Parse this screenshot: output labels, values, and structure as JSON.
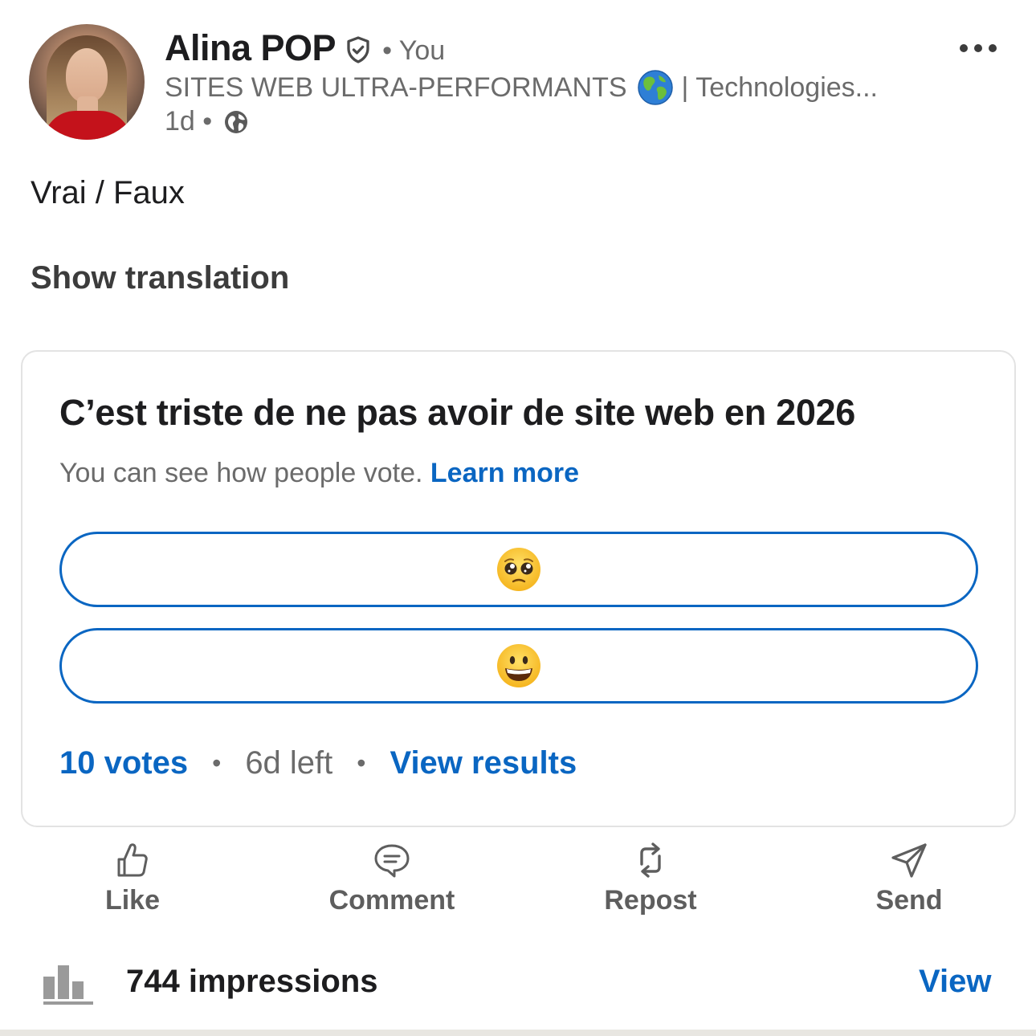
{
  "author": {
    "name": "Alina POP",
    "relation": "• You",
    "headline_text": "SITES WEB ULTRA-PERFORMANTS",
    "headline_suffix": "| Technologies...",
    "time": "1d •",
    "verified_icon": "verified-shield-icon",
    "visibility_icon": "globe-icon"
  },
  "post": {
    "text": "Vrai / Faux",
    "translate_label": "Show translation"
  },
  "poll": {
    "question": "C’est triste de ne pas avoir de site web en 2026",
    "note": "You can see how people vote.",
    "learn_more": "Learn more",
    "options": [
      {
        "emoji": "pleading-face"
      },
      {
        "emoji": "grinning-face"
      }
    ],
    "votes": "10 votes",
    "sep1": "•",
    "time_left": "6d left",
    "sep2": "•",
    "view_results": "View results"
  },
  "actions": {
    "like": "Like",
    "comment": "Comment",
    "repost": "Repost",
    "send": "Send"
  },
  "stats": {
    "impressions": "744 impressions",
    "view": "View"
  },
  "colors": {
    "accent": "#0a66c2",
    "text": "#1d1d1f",
    "muted": "#6b6b6b"
  }
}
